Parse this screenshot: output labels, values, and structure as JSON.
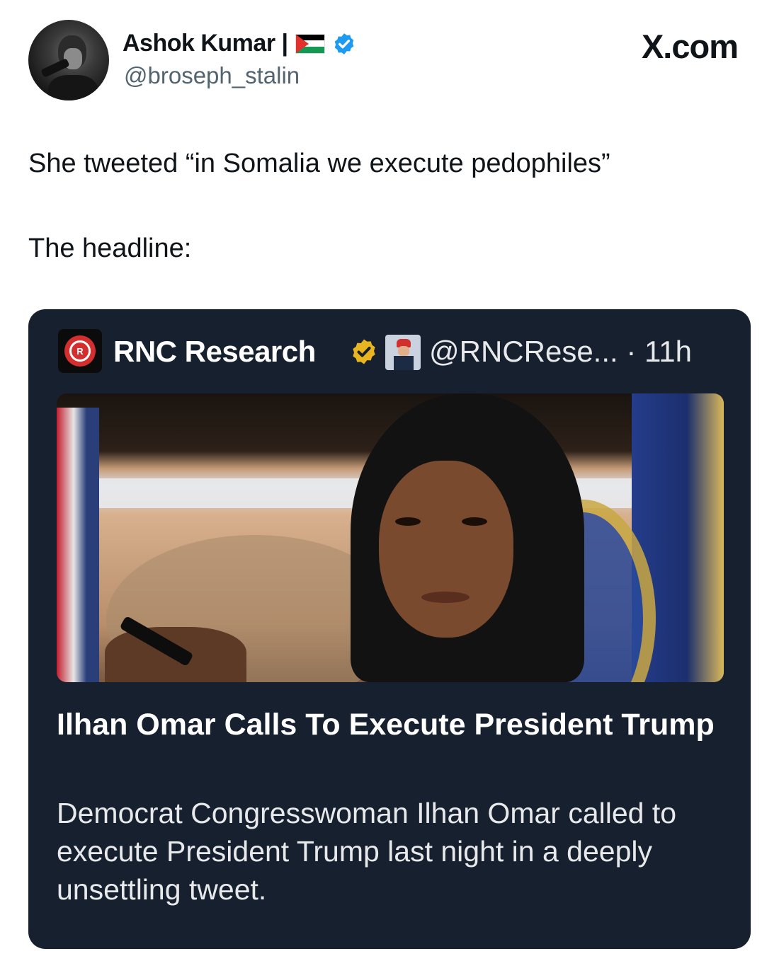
{
  "post": {
    "author_name": "Ashok Kumar |",
    "handle": "@broseph_stalin",
    "brand": "X.com",
    "text_line1": "She tweeted “in Somalia we execute pedophiles”",
    "text_line2": "The headline:"
  },
  "quoted_card": {
    "account_name": "RNC Research",
    "handle_time": "@RNCRese... · 11h",
    "headline": "Ilhan Omar Calls To Execute President Trump",
    "description": "Democrat Congresswoman Ilhan Omar called to execute President Trump last night in a deeply unsettling tweet.",
    "avatar_icon": "rnc-elephant-logo",
    "badge_color": "#e8b41f",
    "card_bg": "#17202e"
  },
  "icons": {
    "verified": "verified-check-icon",
    "flag": "palestine-flag-icon",
    "gold_badge": "gold-verified-badge-icon"
  },
  "colors": {
    "verified_blue": "#1d9bf0",
    "handle_gray": "#536471"
  }
}
